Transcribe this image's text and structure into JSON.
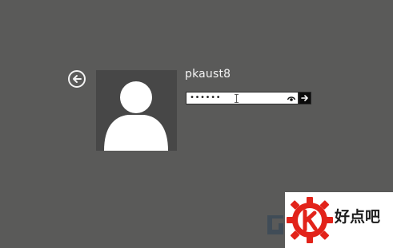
{
  "login": {
    "username": "pkaust8",
    "password_masked": "••••••"
  },
  "icons": {
    "back": "back-arrow-icon",
    "avatar": "user-silhouette-icon",
    "reveal": "eye-icon",
    "submit": "arrow-right-icon",
    "cursor": "text-cursor-icon",
    "logo": "gear-k-logo-icon"
  },
  "watermark": {
    "text": "好点吧"
  },
  "colors": {
    "background": "#5a5a59",
    "avatar_bg": "#474747",
    "logo_red": "#e2231a"
  }
}
